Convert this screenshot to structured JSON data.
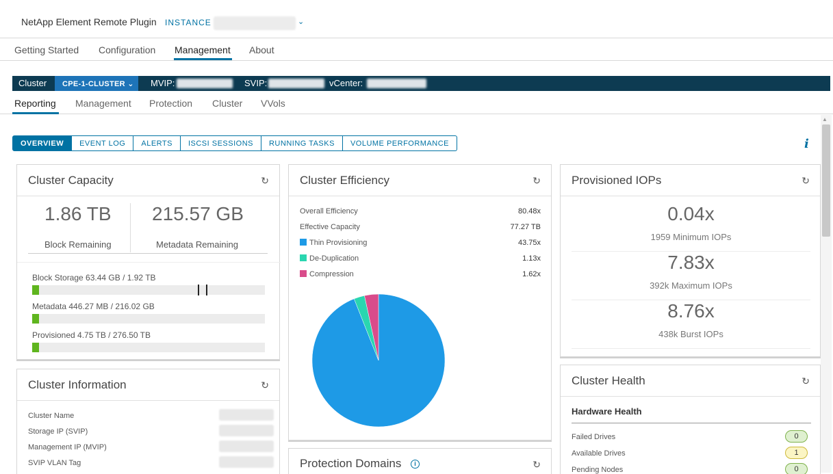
{
  "header": {
    "app_title": "NetApp Element Remote Plugin",
    "instance_label": "INSTANCE"
  },
  "nav": {
    "tabs": [
      "Getting Started",
      "Configuration",
      "Management",
      "About"
    ],
    "active": "Management"
  },
  "cluster_bar": {
    "cluster_label": "Cluster",
    "cluster_name": "CPE-1-CLUSTER",
    "mvip_label": "MVIP:",
    "svip_label": "SVIP:",
    "vcenter_label": "vCenter:"
  },
  "subnav": {
    "tabs": [
      "Reporting",
      "Management",
      "Protection",
      "Cluster",
      "VVols"
    ],
    "active": "Reporting"
  },
  "pills": [
    "OVERVIEW",
    "EVENT LOG",
    "ALERTS",
    "ISCSI SESSIONS",
    "RUNNING TASKS",
    "VOLUME PERFORMANCE"
  ],
  "capacity": {
    "title": "Cluster Capacity",
    "block_remaining": "1.86 TB",
    "block_remaining_label": "Block Remaining",
    "metadata_remaining": "215.57 GB",
    "metadata_remaining_label": "Metadata Remaining",
    "block_storage": "Block Storage 63.44 GB / 1.92 TB",
    "block_fill": 0.03,
    "metadata": "Metadata 446.27 MB / 216.02 GB",
    "metadata_fill": 0.002,
    "provisioned": "Provisioned 4.75 TB / 276.50 TB",
    "provisioned_fill": 0.017
  },
  "efficiency": {
    "title": "Cluster Efficiency",
    "rows": [
      {
        "label": "Overall Efficiency",
        "value": "80.48x"
      },
      {
        "label": "Effective Capacity",
        "value": "77.27 TB"
      },
      {
        "label": "Thin Provisioning",
        "value": "43.75x",
        "color": "#1e9ae6"
      },
      {
        "label": "De-Duplication",
        "value": "1.13x",
        "color": "#2ad6b0"
      },
      {
        "label": "Compression",
        "value": "1.62x",
        "color": "#d94c8b"
      }
    ]
  },
  "chart_data": {
    "type": "pie",
    "categories": [
      "Thin Provisioning",
      "De-Duplication",
      "Compression"
    ],
    "values": [
      94.0,
      2.6,
      3.4
    ],
    "colors": [
      "#1e9ae6",
      "#2ad6b0",
      "#d94c8b"
    ]
  },
  "iops": {
    "title": "Provisioned IOPs",
    "items": [
      {
        "value": "0.04x",
        "label": "1959 Minimum IOPs"
      },
      {
        "value": "7.83x",
        "label": "392k Maximum IOPs"
      },
      {
        "value": "8.76x",
        "label": "438k Burst IOPs"
      }
    ]
  },
  "cluster_info": {
    "title": "Cluster Information",
    "rows": [
      "Cluster Name",
      "Storage IP (SVIP)",
      "Management IP (MVIP)",
      "SVIP VLAN Tag"
    ]
  },
  "protection": {
    "title": "Protection Domains"
  },
  "health": {
    "title": "Cluster Health",
    "subtitle": "Hardware Health",
    "rows": [
      {
        "label": "Failed Drives",
        "value": "0",
        "color": "#dff0d0",
        "border": "#7fb24c"
      },
      {
        "label": "Available Drives",
        "value": "1",
        "color": "#fbf5c4",
        "border": "#cdb93a"
      },
      {
        "label": "Pending Nodes",
        "value": "0",
        "color": "#dff0d0",
        "border": "#7fb24c"
      }
    ]
  }
}
